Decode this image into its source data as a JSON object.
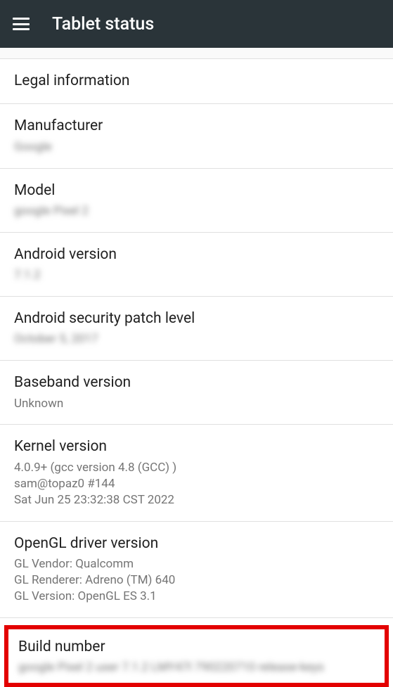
{
  "header": {
    "title": "Tablet status"
  },
  "items": {
    "legal": {
      "title": "Legal information"
    },
    "manufacturer": {
      "title": "Manufacturer",
      "value": "Google"
    },
    "model": {
      "title": "Model",
      "value": "google Pixel 2"
    },
    "android_version": {
      "title": "Android version",
      "value": "7.1.2"
    },
    "security_patch": {
      "title": "Android security patch level",
      "value": "October 5, 2017"
    },
    "baseband": {
      "title": "Baseband version",
      "value": "Unknown"
    },
    "kernel": {
      "title": "Kernel version",
      "value": "4.0.9+ (gcc version 4.8 (GCC) )\nsam@topaz0 #144\nSat Jun 25 23:32:38 CST 2022"
    },
    "opengl": {
      "title": "OpenGL driver version",
      "value": "GL Vendor: Qualcomm\nGL Renderer: Adreno (TM) 640\nGL Version: OpenGL ES 3.1"
    },
    "build": {
      "title": "Build number",
      "value": "google Pixel 2 user 7.1.2 LMY47I 790220710 release-keys"
    }
  }
}
